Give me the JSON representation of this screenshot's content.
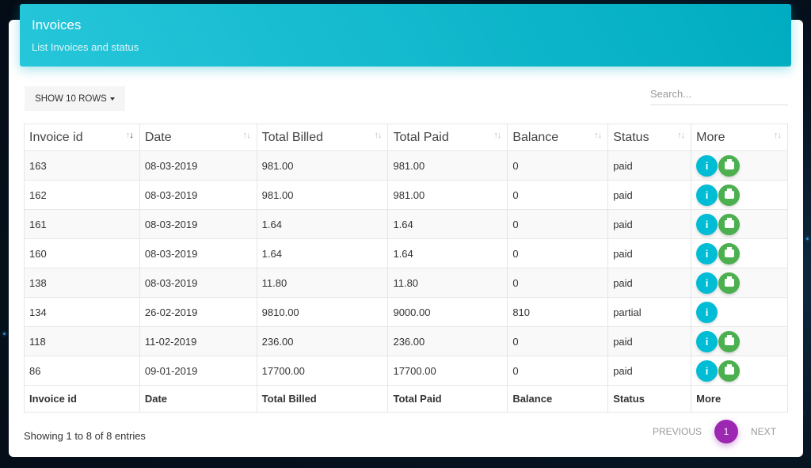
{
  "header": {
    "title": "Invoices",
    "subtitle": "List Invoices and status"
  },
  "controls": {
    "rows_label": "SHOW 10 ROWS",
    "search_placeholder": "Search..."
  },
  "columns": [
    "Invoice id",
    "Date",
    "Total Billed",
    "Total Paid",
    "Balance",
    "Status",
    "More"
  ],
  "sorted_column": 0,
  "rows": [
    {
      "id": "163",
      "date": "08-03-2019",
      "billed": "981.00",
      "paid": "981.00",
      "balance": "0",
      "status": "paid",
      "print": true
    },
    {
      "id": "162",
      "date": "08-03-2019",
      "billed": "981.00",
      "paid": "981.00",
      "balance": "0",
      "status": "paid",
      "print": true
    },
    {
      "id": "161",
      "date": "08-03-2019",
      "billed": "1.64",
      "paid": "1.64",
      "balance": "0",
      "status": "paid",
      "print": true
    },
    {
      "id": "160",
      "date": "08-03-2019",
      "billed": "1.64",
      "paid": "1.64",
      "balance": "0",
      "status": "paid",
      "print": true
    },
    {
      "id": "138",
      "date": "08-03-2019",
      "billed": "11.80",
      "paid": "11.80",
      "balance": "0",
      "status": "paid",
      "print": true
    },
    {
      "id": "134",
      "date": "26-02-2019",
      "billed": "9810.00",
      "paid": "9000.00",
      "balance": "810",
      "status": "partial",
      "print": false
    },
    {
      "id": "118",
      "date": "11-02-2019",
      "billed": "236.00",
      "paid": "236.00",
      "balance": "0",
      "status": "paid",
      "print": true
    },
    {
      "id": "86",
      "date": "09-01-2019",
      "billed": "17700.00",
      "paid": "17700.00",
      "balance": "0",
      "status": "paid",
      "print": true
    }
  ],
  "footer": {
    "showing": "Showing 1 to 8 of 8 entries",
    "previous": "PREVIOUS",
    "page": "1",
    "next": "NEXT"
  },
  "icons": {
    "info": "info-icon",
    "print": "print-icon"
  },
  "colors": {
    "header": "#00acc1",
    "info": "#00bcd4",
    "print": "#4caf50",
    "page_active": "#9c27b0"
  }
}
